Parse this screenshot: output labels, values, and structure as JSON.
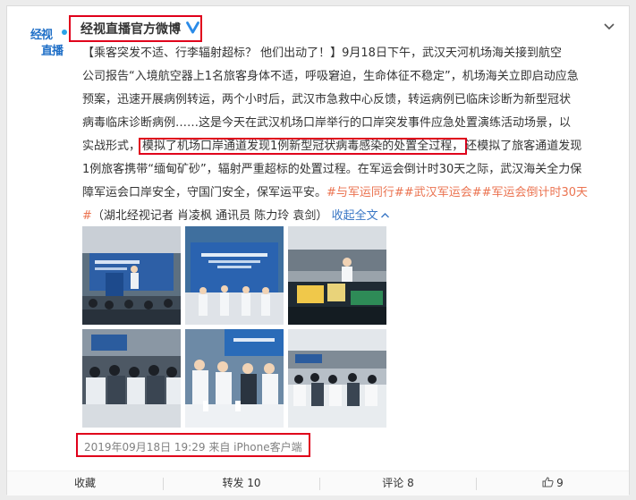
{
  "account": {
    "avatar_line1": "经视",
    "avatar_line2": "直播",
    "name": "经视直播官方微博"
  },
  "post": {
    "lines": [
      "【乘客突发不适、行李辐射超标？ 他们出动了！】9月18日下午，武汉天河机场海关接到航空",
      "公司报告“入境航空器上1名旅客身体不适，呼吸窘迫，生命体征不稳定”，机场海关立即启动应急",
      "预案，迅速开展病例转运，两个小时后，武汉市急救中心反馈，转运病例已临床诊断为新型冠状",
      "病毒临床诊断病例……这是今天在武汉机场口岸举行的口岸突发事件应急处置演练活动场景，以"
    ],
    "line5_pre": "实战形式，",
    "line5_highlight": "模拟了机场口岸通道发现1例新型冠状病毒感染的处置全过程，",
    "line5_post": "还模拟了旅客通道发现",
    "line6": "1例旅客携带“缅甸矿砂”，辐射严重超标的处置过程。在军运会倒计时30天之际，武汉海关全力保",
    "line7_text": "障军运会口岸安全，守国门安全，保军运平安。",
    "line7_tags": "#与军运同行##武汉军运会##军运会倒计时30天",
    "line8_tag_end": "#",
    "line8_credit": "（湖北经视记者 肖凌枫 通讯员 陈力玲 袁剑）",
    "collapse_label": "收起全文"
  },
  "meta": {
    "timestamp": "2019年09月18日 19:29",
    "source": "来自 iPhone客户端"
  },
  "actions": {
    "favorite": "收藏",
    "repost": "转发 10",
    "comment": "评论 8",
    "like_count": "9"
  },
  "colors": {
    "highlight_border": "#e0001b",
    "link": "#eb7350",
    "verified": "#2b8be8"
  },
  "icons": [
    "verified-badge-icon",
    "chevron-down-icon",
    "chevron-up-icon",
    "thumbs-up-icon"
  ]
}
